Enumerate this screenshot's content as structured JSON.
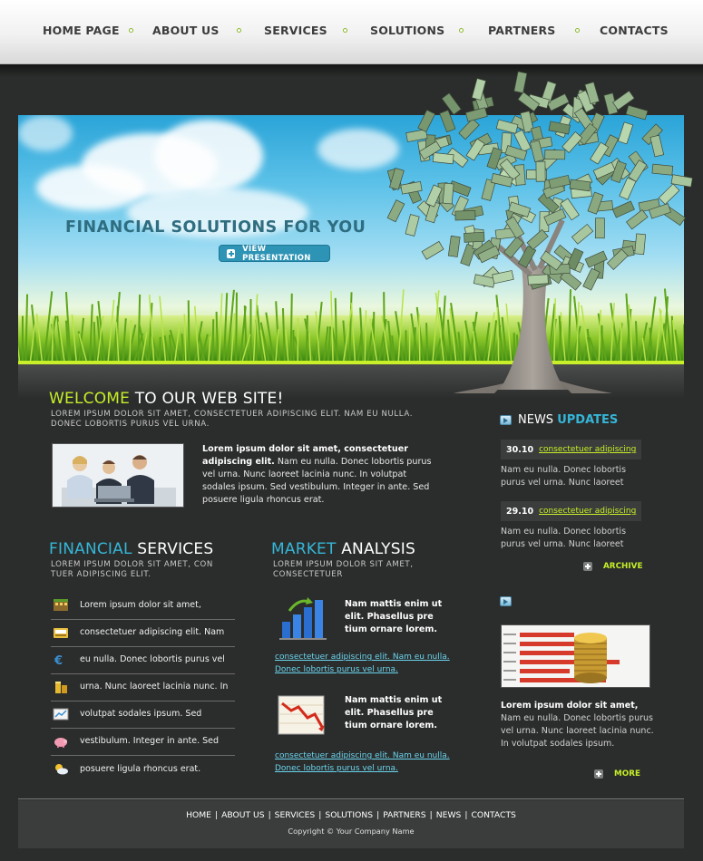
{
  "nav": {
    "items": [
      "HOME PAGE",
      "ABOUT US",
      "SERVICES",
      "SOLUTIONS",
      "PARTNERS",
      "CONTACTS"
    ]
  },
  "hero": {
    "title": "FINANCIAL SOLUTIONS FOR YOU",
    "button_label": "VIEW PRESENTATION"
  },
  "welcome": {
    "title_highlight": "WELCOME",
    "title_rest": " TO OUR WEB SITE!",
    "subtitle": "LOREM IPSUM DOLOR SIT AMET, CONSECTETUER ADIPISCING ELIT. NAM EU NULLA. DONEC LOBORTIS PURUS VEL URNA.",
    "bold_text": "Lorem ipsum dolor sit amet, consectetuer adipiscing elit.",
    "text": " Nam eu nulla. Donec lobortis purus vel urna. Nunc laoreet lacinia nunc. In volutpat sodales ipsum. Sed vestibulum. Integer in ante. Sed posuere ligula rhoncus erat."
  },
  "financial": {
    "title_highlight": "FINANCIAL",
    "title_rest": " SERVICES",
    "subtitle": "LOREM IPSUM DOLOR SIT AMET, CON TUER ADIPISCING ELIT.",
    "items": [
      {
        "label": "Lorem ipsum dolor sit amet,",
        "icon": "building-icon"
      },
      {
        "label": "consectetuer adipiscing elit. Nam",
        "icon": "cash-register-icon"
      },
      {
        "label": "eu nulla. Donec lobortis purus vel",
        "icon": "euro-icon"
      },
      {
        "label": "urna. Nunc laoreet lacinia nunc. In",
        "icon": "coins-icon"
      },
      {
        "label": "volutpat sodales ipsum. Sed",
        "icon": "chart-card-icon"
      },
      {
        "label": "vestibulum. Integer in ante. Sed",
        "icon": "piggy-bank-icon"
      },
      {
        "label": "posuere ligula rhoncus erat.",
        "icon": "weather-icon"
      }
    ]
  },
  "market": {
    "title_highlight": "MARKET",
    "title_rest": " ANALYSIS",
    "subtitle": "LOREM IPSUM DOLOR SIT AMET, CONSECTETUER",
    "blocks": [
      {
        "bold": "Nam mattis enim ut elit. Phasellus pre tium ornare lorem.",
        "link": "consectetuer adipiscing elit. Nam eu nulla. Donec lobortis purus vel urna.",
        "icon": "bar-chart-up-icon"
      },
      {
        "bold": "Nam mattis enim ut elit. Phasellus pre tium ornare lorem.",
        "link": "consectetuer adipiscing elit. Nam eu nulla. Donec lobortis purus vel urna.",
        "icon": "chart-down-icon"
      }
    ]
  },
  "news": {
    "title_plain": "NEWS ",
    "title_highlight": "UPDATES",
    "items": [
      {
        "date": "30.10",
        "link": "consectetuer adipiscing",
        "text": "Nam eu nulla. Donec lobortis purus vel urna. Nunc laoreet"
      },
      {
        "date": "29.10",
        "link": "consectetuer adipiscing",
        "text": "Nam eu nulla. Donec lobortis purus vel urna. Nunc laoreet"
      }
    ],
    "archive_label": "ARCHIVE"
  },
  "side": {
    "bold_text": "Lorem ipsum dolor sit amet,",
    "text": "Nam eu nulla. Donec lobortis purus vel urna. Nunc laoreet lacinia nunc. In volutpat sodales ipsum.",
    "more_label": "MORE"
  },
  "footer": {
    "links": [
      "HOME",
      "ABOUT US",
      "SERVICES",
      "SOLUTIONS",
      "PARTNERS",
      "NEWS",
      "CONTACTS"
    ],
    "copyright": "Copyright © Your Company Name"
  }
}
